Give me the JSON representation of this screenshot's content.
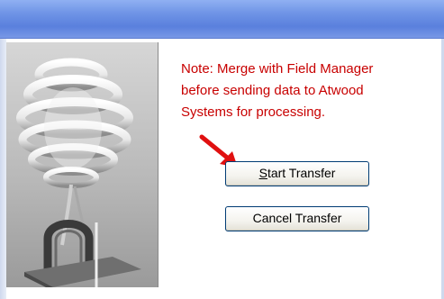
{
  "note": {
    "line1": "Note: Merge with Field Manager",
    "line2": "before sending data to Atwood",
    "line3": "Systems for processing."
  },
  "buttons": {
    "start_accel": "S",
    "start_rest": "tart Transfer",
    "cancel_label": "Cancel Transfer"
  },
  "colors": {
    "note_text": "#c80000",
    "arrow": "#e01010",
    "titlebar": "#6f94e6"
  },
  "icons": {
    "pointer": "red-arrow-icon",
    "illustration": "spiral-sculpture-image"
  }
}
